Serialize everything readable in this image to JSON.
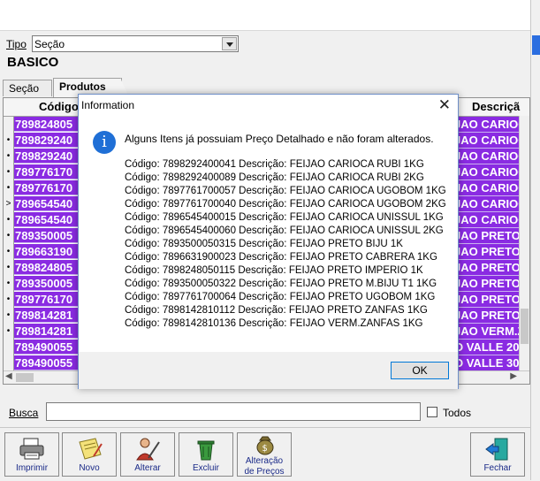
{
  "filter": {
    "tipo_label": "Tipo",
    "tipo_value": "Seção",
    "group_name": "BASICO"
  },
  "tabs": [
    {
      "label": "Seção"
    },
    {
      "label": "Produtos"
    }
  ],
  "grid": {
    "headers": {
      "code": "Código",
      "description": "Descriçã"
    },
    "rows": [
      {
        "marker": "",
        "code": "789824805",
        "desc": "JAO CARIOC"
      },
      {
        "marker": "•",
        "code": "789829240",
        "desc": "JAO CARIOC"
      },
      {
        "marker": "•",
        "code": "789829240",
        "desc": "JAO CARIOC"
      },
      {
        "marker": "•",
        "code": "789776170",
        "desc": "JAO CARIOC"
      },
      {
        "marker": "•",
        "code": "789776170",
        "desc": "JAO CARIOC"
      },
      {
        "marker": ">",
        "code": "789654540",
        "desc": "JAO CARIOC"
      },
      {
        "marker": "•",
        "code": "789654540",
        "desc": "JAO CARIOC"
      },
      {
        "marker": "•",
        "code": "789350005",
        "desc": "JAO PRETO"
      },
      {
        "marker": "•",
        "code": "789663190",
        "desc": "JAO PRETO"
      },
      {
        "marker": "•",
        "code": "789824805",
        "desc": "JAO PRETO"
      },
      {
        "marker": "•",
        "code": "789350005",
        "desc": "JAO PRETO"
      },
      {
        "marker": "•",
        "code": "789776170",
        "desc": "JAO PRETO"
      },
      {
        "marker": "•",
        "code": "789814281",
        "desc": "JAO PRETO"
      },
      {
        "marker": "•",
        "code": "789814281",
        "desc": "JAO VERM.Z"
      },
      {
        "marker": "",
        "code": "789490055",
        "desc": "O VALLE 20"
      },
      {
        "marker": "",
        "code": "789490055",
        "desc": "O VALLE 30"
      }
    ]
  },
  "search": {
    "label": "Busca",
    "value": "",
    "todos_label": "Todos"
  },
  "toolbar": {
    "imprimir": "Imprimir",
    "novo": "Novo",
    "alterar": "Alterar",
    "excluir": "Excluir",
    "alteracao_line1": "Alteração",
    "alteracao_line2": "de Preços",
    "fechar": "Fechar"
  },
  "dialog": {
    "title": "Information",
    "close_glyph": "✕",
    "icon_glyph": "i",
    "message": "Alguns Itens já possuiam Preço Detalhado e não foram alterados.",
    "lines": [
      "Código: 7898292400041 Descrição: FEIJAO CARIOCA RUBI 1KG",
      "Código: 7898292400089 Descrição: FEIJAO CARIOCA RUBI 2KG",
      "Código: 7897761700057 Descrição: FEIJAO CARIOCA UGOBOM 1KG",
      "Código: 7897761700040 Descrição: FEIJAO CARIOCA UGOBOM 2KG",
      "Código: 7896545400015 Descrição: FEIJAO CARIOCA UNISSUL 1KG",
      "Código: 7896545400060 Descrição: FEIJAO CARIOCA UNISSUL 2KG",
      "Código: 7893500050315 Descrição: FEIJAO PRETO BIJU 1K",
      "Código: 7896631900023 Descrição: FEIJAO PRETO CABRERA 1KG",
      "Código: 7898248050115 Descrição: FEIJAO PRETO IMPERIO 1K",
      "Código: 7893500050322 Descrição: FEIJAO PRETO M.BIJU T1 1KG",
      "Código: 7897761700064 Descrição: FEIJAO PRETO UGOBOM 1KG",
      "Código: 7898142810112 Descrição: FEIJAO PRETO ZANFAS 1KG",
      "Código: 7898142810136 Descrição: FEIJAO VERM.ZANFAS 1KG"
    ],
    "ok_label": "OK"
  },
  "colors": {
    "row_highlight": "#8a2be2",
    "info_icon": "#1f6fd6",
    "focus_border": "#0078d7"
  }
}
